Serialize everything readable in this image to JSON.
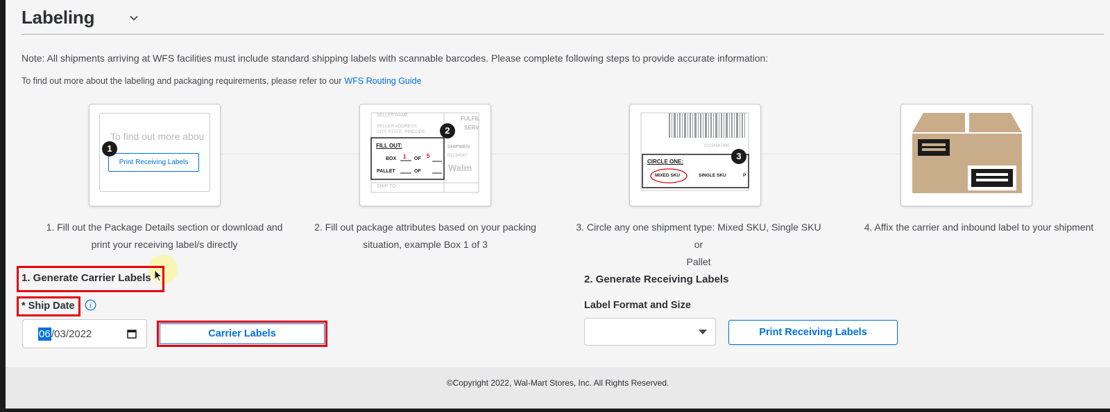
{
  "section": {
    "title": "Labeling",
    "collapse_icon": "chevron-down-icon"
  },
  "note": "Note: All shipments arriving at WFS facilities must include standard shipping labels with scannable barcodes. Please complete following steps to provide accurate information:",
  "refer": {
    "text": "To find out more about the labeling and packaging requirements, please refer to our",
    "link": "WFS Routing Guide"
  },
  "steps": [
    {
      "badge": "1",
      "caption_line1": "1. Fill out the Package Details section or download and",
      "caption_line2": "print your receiving label/s directly",
      "preview_text": "To find out more abou",
      "preview_button": "Print Receiving Labels"
    },
    {
      "badge": "2",
      "caption_line1": "2. Fill out package attributes based on your packing",
      "caption_line2": "situation, example Box 1 of 3",
      "seller_name": "SELLER NAME",
      "seller_address": "SELLER ADDRESS",
      "city_state": "CITY STATE, PINCODE",
      "fulfil": "FULFIL",
      "serv": "SERV",
      "fill_out": "FILL OUT:",
      "box": "BOX",
      "box_num": "1",
      "of": "OF",
      "box_total": "5",
      "pallet": "PALLET",
      "shipment": "SHIPMEN",
      "shipment_num": "01234567",
      "walm": "Walm",
      "ship_to": "SHIP TO:"
    },
    {
      "badge": "3",
      "caption_line1": "3. Circle any one shipment type: Mixed SKU, Single SKU or",
      "caption_line2": "Pallet",
      "barcode_num": "01234567890",
      "circle_one": "CIRCLE ONE:",
      "mixed_sku": "MIXED SKU",
      "single_sku": "SINGLE SKU",
      "pallet_abbrev": "P"
    },
    {
      "caption_line1": "4. Affix the carrier and inbound label to your shipment",
      "icon": "package-box-icon"
    }
  ],
  "carrier": {
    "title": "1. Generate Carrier Labels",
    "ship_date_label": "* Ship Date",
    "info_icon": "info-icon",
    "date_month": "06",
    "date_rest": "/03/2022",
    "calendar_icon": "calendar-icon",
    "button": "Carrier Labels"
  },
  "receiving": {
    "title": "2. Generate Receiving Labels",
    "format_label": "Label Format and Size",
    "select_value": "",
    "button": "Print Receiving Labels"
  },
  "footer": {
    "copyright": "©Copyright 2022, Wal-Mart Stores, Inc. All Rights Reserved."
  },
  "colors": {
    "accent": "#0071dc",
    "highlight": "#e5000d",
    "background": "#f5f5f6",
    "box_tan": "#c9ad8a"
  }
}
